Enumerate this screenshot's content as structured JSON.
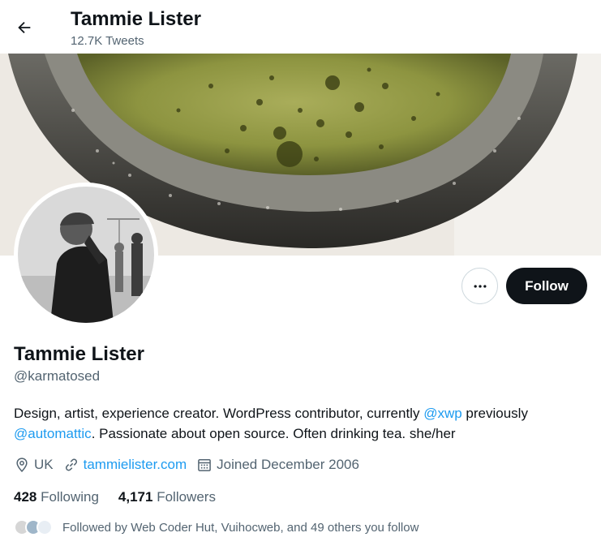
{
  "header": {
    "title": "Tammie Lister",
    "tweet_count": "12.7K Tweets"
  },
  "profile": {
    "name": "Tammie Lister",
    "handle": "@karmatosed",
    "follow_label": "Follow",
    "bio": {
      "part1": "Design, artist, experience creator. WordPress contributor, currently ",
      "mention1": "@xwp",
      "part2": " previously ",
      "mention2": "@automattic",
      "part3": ". Passionate about open source. Often drinking tea. she/her"
    },
    "location": "UK",
    "website": "tammielister.com",
    "joined": "Joined December 2006",
    "following_count": "428",
    "following_label": "Following",
    "followers_count": "4,171",
    "followers_label": "Followers",
    "followed_by": "Followed by Web Coder Hut, Vuihocweb, and 49 others you follow"
  },
  "icons": {
    "back": "arrow-left-icon",
    "more": "more-horizontal-icon",
    "location": "location-pin-icon",
    "link": "link-icon",
    "calendar": "calendar-icon"
  },
  "colors": {
    "accent": "#1d9bf0",
    "text": "#0f1419",
    "secondary": "#536471",
    "follow_bg": "#0f1419"
  }
}
